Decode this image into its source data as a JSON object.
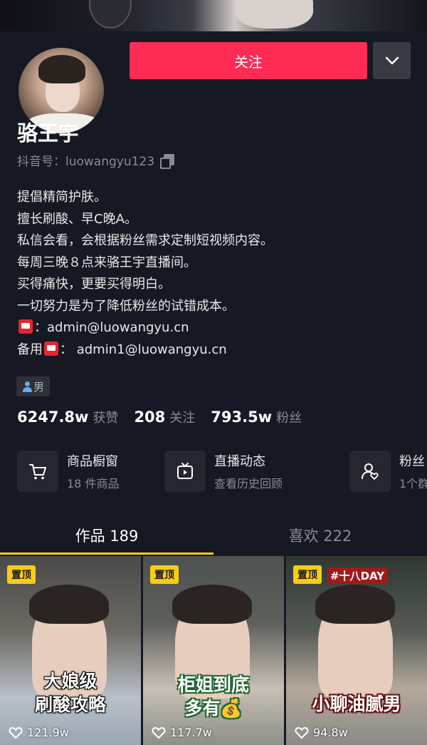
{
  "header": {
    "follow_label": "关注"
  },
  "profile": {
    "name": "骆王宇",
    "id_line": "抖音号：luowangyu123",
    "bio": [
      "提倡精简护肤。",
      "擅长刷酸、早C晚A。",
      "私信会看，会根据粉丝需求定制短视频内容。",
      "每周三晚８点来骆王宇直播间。",
      "买得痛快，更要买得明白。",
      "一切努力是为了降低粉丝的试错成本。"
    ],
    "email_prefix": "：",
    "email": "admin@luowangyu.cn",
    "backup_prefix": "备用",
    "backup_email": "：  admin1@luowangyu.cn",
    "gender": "男"
  },
  "stats": [
    {
      "value": "6247.8w",
      "label": "获赞"
    },
    {
      "value": "208",
      "label": "关注"
    },
    {
      "value": "793.5w",
      "label": "粉丝"
    }
  ],
  "features": [
    {
      "title": "商品橱窗",
      "subtitle": "18 件商品",
      "icon": "cart-icon"
    },
    {
      "title": "直播动态",
      "subtitle": "查看历史回顾",
      "icon": "live-tv-icon"
    },
    {
      "title": "粉丝",
      "subtitle": "1个群",
      "icon": "fans-group-icon"
    }
  ],
  "tabs": [
    {
      "label": "作品 189",
      "active": true
    },
    {
      "label": "喜欢 222",
      "active": false
    }
  ],
  "videos": [
    {
      "pin": "置顶",
      "caption_line1": "大娘级",
      "caption_line2": "刷酸攻略",
      "likes": "121.9w"
    },
    {
      "pin": "置顶",
      "caption_line1": "柜姐到底",
      "caption_line2": "多有💰",
      "likes": "117.7w"
    },
    {
      "pin": "置顶",
      "caption_line1": "小聊油腻男",
      "caption_line2": "",
      "overlay": "#十八DAY",
      "likes": "94.8w"
    }
  ],
  "colors": {
    "background": "#161823",
    "follow": "#fe2c55",
    "tab_indicator": "#facd14",
    "pin_badge": "#facd14"
  }
}
